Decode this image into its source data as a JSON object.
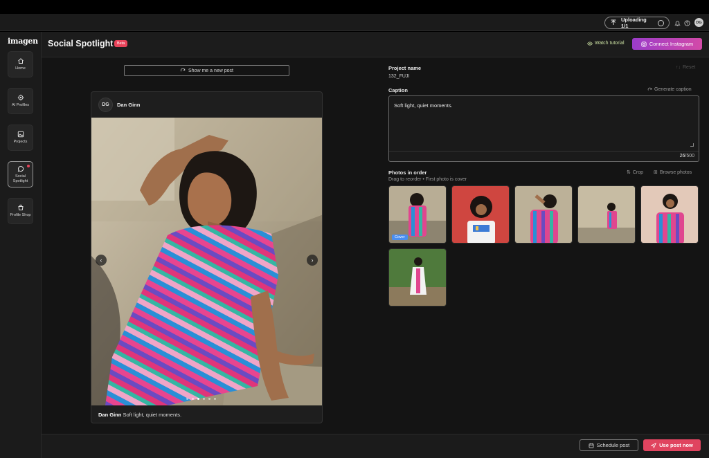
{
  "app": {
    "logo": "imagen"
  },
  "topbar": {
    "upload_status": "Uploading 1/1",
    "user_initials": "DG"
  },
  "sidebar": {
    "items": [
      {
        "label": "Home"
      },
      {
        "label": "AI Profiles"
      },
      {
        "label": "Projects"
      },
      {
        "label": "Social Spotlight"
      },
      {
        "label": "Profile Shop"
      }
    ]
  },
  "header": {
    "title": "Social Spotlight",
    "badge": "Beta",
    "watch_tutorial": "Watch tutorial",
    "connect_instagram": "Connect Instagram"
  },
  "preview": {
    "show_new_post": "Show me a new post",
    "user_initials": "DG",
    "user_name": "Dan Ginn",
    "caption": "Soft light, quiet moments.",
    "carousel_total": 6,
    "carousel_index": 2
  },
  "editor": {
    "project_label": "Project name",
    "project_name": "132_FUJI",
    "reset": "Reset",
    "caption_label": "Caption",
    "generate_caption": "Generate caption",
    "caption_text": "Soft light, quiet moments.",
    "char_count": "26",
    "char_max": "/500",
    "photos_label": "Photos in order",
    "photos_hint": "Drag to reorder  •  First photo is cover",
    "crop": "Crop",
    "browse": "Browse photos",
    "cover_badge": "Cover"
  },
  "footer": {
    "schedule": "Schedule post",
    "use_now": "Use post now"
  },
  "colors": {
    "accent": "#e0445f",
    "instagram_start": "#9b3cc9",
    "instagram_end": "#d34aa8",
    "tutorial": "#cde3a4",
    "cover": "#4a8ef0"
  }
}
